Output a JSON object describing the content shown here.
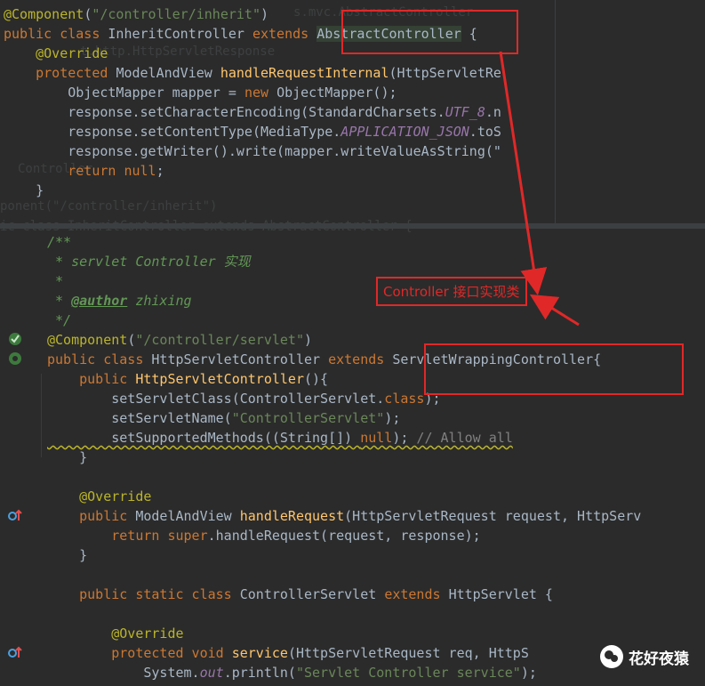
{
  "top_code": {
    "lines": [
      [
        {
          "c": "ann",
          "t": "@Component"
        },
        {
          "c": "plain",
          "t": "("
        },
        {
          "c": "str",
          "t": "\"/controller/inherit\""
        },
        {
          "c": "plain",
          "t": ")"
        }
      ],
      [
        {
          "c": "kw",
          "t": "public class "
        },
        {
          "c": "id",
          "t": "InheritController "
        },
        {
          "c": "kw",
          "t": "extends "
        },
        {
          "c": "hl",
          "t": "AbstractController"
        },
        {
          "c": "plain",
          "t": " {"
        }
      ],
      [
        {
          "c": "ann",
          "t": "    @Override"
        }
      ],
      [
        {
          "c": "kw",
          "t": "    protected "
        },
        {
          "c": "id",
          "t": "ModelAndView "
        },
        {
          "c": "fn",
          "t": "handleRequestInternal"
        },
        {
          "c": "plain",
          "t": "(HttpServletRe"
        }
      ],
      [
        {
          "c": "plain",
          "t": "        ObjectMapper mapper = "
        },
        {
          "c": "kw",
          "t": "new "
        },
        {
          "c": "plain",
          "t": "ObjectMapper();"
        }
      ],
      [
        {
          "c": "plain",
          "t": "        response.setCharacterEncoding(StandardCharsets."
        },
        {
          "c": "ital",
          "t": "UTF_8"
        },
        {
          "c": "plain",
          "t": ".n"
        }
      ],
      [
        {
          "c": "plain",
          "t": "        response.setContentType(MediaType."
        },
        {
          "c": "ital",
          "t": "APPLICATION_JSON"
        },
        {
          "c": "plain",
          "t": ".toS"
        }
      ],
      [
        {
          "c": "plain",
          "t": "        response.getWriter().write(mapper.writeValueAsString(\""
        }
      ],
      [
        {
          "c": "kw",
          "t": "        return null"
        },
        {
          "c": "plain",
          "t": ";"
        }
      ],
      [
        {
          "c": "plain",
          "t": "    }"
        }
      ]
    ],
    "ghost_lines": [
      "s.mvc.AbstractController",
      "t.http.HttpServletResponse",
      "Controller",
      "ponent(\"/controller/inherit\")",
      "ic class InheritController extends AbstractController {"
    ]
  },
  "bottom_code": {
    "lines": [
      [
        {
          "c": "cm",
          "t": "/**"
        }
      ],
      [
        {
          "c": "cm",
          "t": " * servlet Controller 实现"
        }
      ],
      [
        {
          "c": "cm",
          "t": " *"
        }
      ],
      [
        {
          "c": "cm",
          "t": " * "
        },
        {
          "c": "cmtag",
          "t": "@author"
        },
        {
          "c": "cm",
          "t": " zhixing"
        }
      ],
      [
        {
          "c": "cm",
          "t": " */"
        }
      ],
      [
        {
          "c": "ann",
          "t": "@Component"
        },
        {
          "c": "plain",
          "t": "("
        },
        {
          "c": "str",
          "t": "\"/controller/servlet\""
        },
        {
          "c": "plain",
          "t": ")"
        }
      ],
      [
        {
          "c": "kw",
          "t": "public class "
        },
        {
          "c": "id",
          "t": "HttpServletController "
        },
        {
          "c": "kw",
          "t": "extends "
        },
        {
          "c": "id",
          "t": "ServletWrappingController"
        },
        {
          "c": "plain",
          "t": "{"
        }
      ],
      [
        {
          "c": "kw",
          "t": "    public "
        },
        {
          "c": "fn",
          "t": "HttpServletController"
        },
        {
          "c": "plain",
          "t": "(){"
        }
      ],
      [
        {
          "c": "plain",
          "t": "        setServletClass(ControllerServlet."
        },
        {
          "c": "kw",
          "t": "class"
        },
        {
          "c": "plain",
          "t": ");"
        }
      ],
      [
        {
          "c": "plain",
          "t": "        setServletName("
        },
        {
          "c": "str",
          "t": "\"ControllerServlet\""
        },
        {
          "c": "plain",
          "t": ");"
        }
      ],
      [
        {
          "c": "plain",
          "t": "        setSupportedMethods((String[]) "
        },
        {
          "c": "kw",
          "t": "null"
        },
        {
          "c": "plain",
          "t": "); "
        },
        {
          "c": "gray",
          "t": "// Allow all"
        }
      ],
      [
        {
          "c": "plain",
          "t": "    }"
        }
      ],
      [
        {
          "c": "plain",
          "t": ""
        }
      ],
      [
        {
          "c": "ann",
          "t": "    @Override"
        }
      ],
      [
        {
          "c": "kw",
          "t": "    public "
        },
        {
          "c": "plain",
          "t": "ModelAndView "
        },
        {
          "c": "fn",
          "t": "handleRequest"
        },
        {
          "c": "plain",
          "t": "(HttpServletRequest request, HttpServ"
        }
      ],
      [
        {
          "c": "kw",
          "t": "        return super"
        },
        {
          "c": "plain",
          "t": ".handleRequest(request, response);"
        }
      ],
      [
        {
          "c": "plain",
          "t": "    }"
        }
      ],
      [
        {
          "c": "plain",
          "t": ""
        }
      ],
      [
        {
          "c": "kw",
          "t": "    public static class "
        },
        {
          "c": "plain",
          "t": "ControllerServlet "
        },
        {
          "c": "kw",
          "t": "extends "
        },
        {
          "c": "plain",
          "t": "HttpServlet {"
        }
      ],
      [
        {
          "c": "plain",
          "t": ""
        }
      ],
      [
        {
          "c": "ann",
          "t": "        @Override"
        }
      ],
      [
        {
          "c": "kw",
          "t": "        protected void "
        },
        {
          "c": "fn",
          "t": "service"
        },
        {
          "c": "plain",
          "t": "(HttpServletRequest req, HttpS"
        }
      ],
      [
        {
          "c": "plain",
          "t": "            System."
        },
        {
          "c": "ital",
          "t": "out"
        },
        {
          "c": "plain",
          "t": ".println("
        },
        {
          "c": "str",
          "t": "\"Servlet Controller service\""
        },
        {
          "c": "plain",
          "t": ");"
        }
      ]
    ],
    "ghost_lines": [
      "ic class InheritController extends AbstractController {"
    ]
  },
  "callout": {
    "label": "Controller 接口实现类"
  },
  "watermark": {
    "label": "花好夜猿"
  },
  "colors": {
    "accent_red": "#e02828",
    "bg": "#2b2b2b"
  },
  "icons": [
    "bean-check-icon",
    "bean-icon",
    "override-up-icon",
    "override-up-icon"
  ]
}
